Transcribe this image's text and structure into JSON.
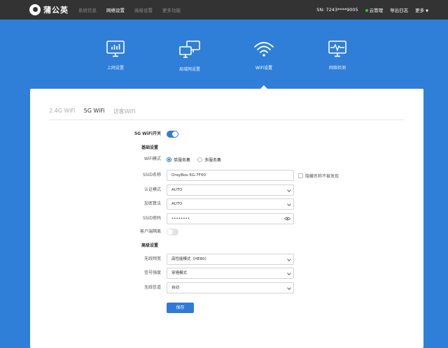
{
  "brand": {
    "name": "蒲公英"
  },
  "nav": {
    "items": [
      {
        "label": "系统信息"
      },
      {
        "label": "网络设置"
      },
      {
        "label": "高级设置"
      },
      {
        "label": "更多功能"
      }
    ],
    "active_index": 1
  },
  "top_right": {
    "sn_label": "SN: 7243****9005",
    "cloud_label": "云管理",
    "export_log_label": "导出日志",
    "more_label": "更多",
    "cloud_status_color": "#35c24a"
  },
  "categories": [
    {
      "label": "上网设置",
      "icon": "monitor-icon"
    },
    {
      "label": "局域网设置",
      "icon": "lan-icon"
    },
    {
      "label": "WiFi设置",
      "icon": "wifi-icon"
    },
    {
      "label": "网络检测",
      "icon": "network-check-icon"
    }
  ],
  "active_category": 2,
  "tabs": [
    {
      "label": "2.4G WiFi"
    },
    {
      "label": "5G WiFi"
    },
    {
      "label": "访客WiFi"
    }
  ],
  "active_tab": 1,
  "form": {
    "wifi_switch": {
      "label": "5G WiFi开关",
      "on": true
    },
    "basic_section": "基础设置",
    "wifi_mode": {
      "label": "WiFi模式",
      "options": [
        {
          "label": "单服务集",
          "selected": true
        },
        {
          "label": "多服务集",
          "selected": false
        }
      ]
    },
    "ssid": {
      "label": "SSID名称",
      "value": "OrayBox-5G-7F00"
    },
    "hide_ssid": {
      "label": "隐藏名称不被发现",
      "checked": false
    },
    "auth_mode": {
      "label": "认证模式",
      "value": "AUTO"
    },
    "encryption": {
      "label": "加密算法",
      "value": "AUTO"
    },
    "password": {
      "label": "SSID密码",
      "value": "••••••••"
    },
    "client_isolation": {
      "label": "客户端隔离",
      "on": false
    },
    "advanced_section": "高级设置",
    "bandwidth": {
      "label": "无线频宽",
      "value": "高性能模式（HE80）"
    },
    "signal_strength": {
      "label": "信号强度",
      "value": "穿墙模式"
    },
    "channel": {
      "label": "无线信道",
      "value": "自动"
    },
    "save_label": "保存"
  },
  "colors": {
    "accent": "#2f7ad6",
    "background": "#2f7fd8",
    "topbar": "#333333"
  }
}
